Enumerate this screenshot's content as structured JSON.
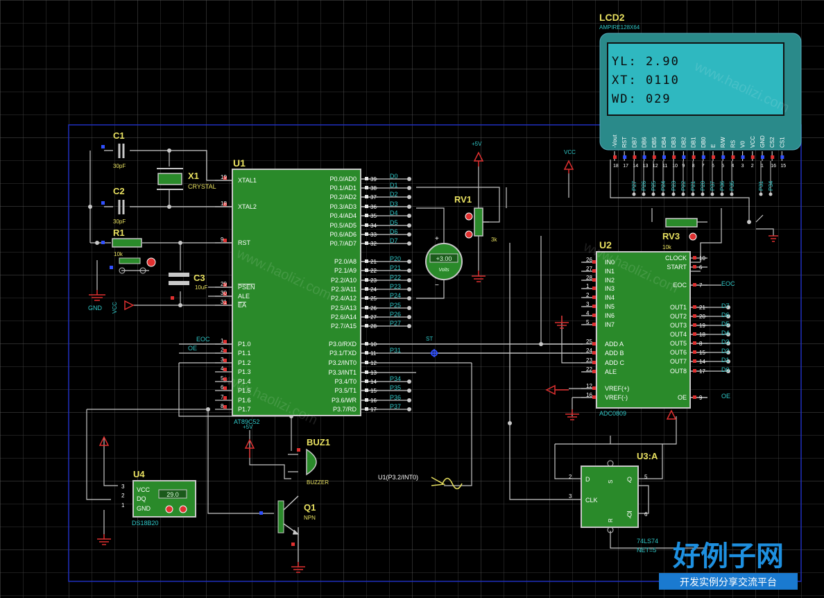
{
  "colors": {
    "background": "#000000",
    "grid": "#3a3a3a",
    "wire": "#c8c8c8",
    "chip_fill": "#2a8a2a",
    "chip_border": "#c8c8c8",
    "label_yellow": "#e8e060",
    "net_cyan": "#30c8c8",
    "pin_red": "#e03030",
    "power_red": "#e03030",
    "lcd_bg": "#2fb8c0",
    "sheet_border": "#2030c0"
  },
  "u1": {
    "ref": "U1",
    "part": "AT89C52",
    "left_pins": [
      {
        "num": "19",
        "name": "XTAL1"
      },
      {
        "num": "18",
        "name": "XTAL2"
      },
      {
        "num": "9",
        "name": "RST"
      },
      {
        "num": "29",
        "name": "PSEN"
      },
      {
        "num": "30",
        "name": "ALE"
      },
      {
        "num": "31",
        "name": "EA"
      },
      {
        "num": "1",
        "name": "P1.0"
      },
      {
        "num": "2",
        "name": "P1.1"
      },
      {
        "num": "3",
        "name": "P1.2"
      },
      {
        "num": "4",
        "name": "P1.3"
      },
      {
        "num": "5",
        "name": "P1.4"
      },
      {
        "num": "6",
        "name": "P1.5"
      },
      {
        "num": "7",
        "name": "P1.6"
      },
      {
        "num": "8",
        "name": "P1.7"
      }
    ],
    "right_pins": [
      {
        "num": "39",
        "name": "P0.0/AD0",
        "net": "D0"
      },
      {
        "num": "38",
        "name": "P0.1/AD1",
        "net": "D1"
      },
      {
        "num": "37",
        "name": "P0.2/AD2",
        "net": "D2"
      },
      {
        "num": "36",
        "name": "P0.3/AD3",
        "net": "D3"
      },
      {
        "num": "35",
        "name": "P0.4/AD4",
        "net": "D4"
      },
      {
        "num": "34",
        "name": "P0.5/AD5",
        "net": "D5"
      },
      {
        "num": "33",
        "name": "P0.6/AD6",
        "net": "D6"
      },
      {
        "num": "32",
        "name": "P0.7/AD7",
        "net": "D7"
      },
      {
        "num": "21",
        "name": "P2.0/A8",
        "net": "P20"
      },
      {
        "num": "22",
        "name": "P2.1/A9",
        "net": "P21"
      },
      {
        "num": "23",
        "name": "P2.2/A10",
        "net": "P22"
      },
      {
        "num": "24",
        "name": "P2.3/A11",
        "net": "P23"
      },
      {
        "num": "25",
        "name": "P2.4/A12",
        "net": "P24"
      },
      {
        "num": "26",
        "name": "P2.5/A13",
        "net": "P25"
      },
      {
        "num": "27",
        "name": "P2.6/A14",
        "net": "P26"
      },
      {
        "num": "28",
        "name": "P2.7/A15",
        "net": "P27"
      },
      {
        "num": "10",
        "name": "P3.0/RXD",
        "net": ""
      },
      {
        "num": "11",
        "name": "P3.1/TXD",
        "net": "P31"
      },
      {
        "num": "12",
        "name": "P3.2/INT0",
        "net": ""
      },
      {
        "num": "13",
        "name": "P3.3/INT1",
        "net": ""
      },
      {
        "num": "14",
        "name": "P3.4/T0",
        "net": "P34"
      },
      {
        "num": "15",
        "name": "P3.5/T1",
        "net": "P35"
      },
      {
        "num": "16",
        "name": "P3.6/WR",
        "net": "P36"
      },
      {
        "num": "17",
        "name": "P3.7/RD",
        "net": "P37"
      }
    ],
    "left_nets": {
      "p10": "EOC",
      "p11": "OE"
    }
  },
  "u2": {
    "ref": "U2",
    "part": "ADC0809",
    "left_pins": [
      {
        "num": "26",
        "name": "IN0"
      },
      {
        "num": "27",
        "name": "IN1"
      },
      {
        "num": "28",
        "name": "IN2"
      },
      {
        "num": "1",
        "name": "IN3"
      },
      {
        "num": "2",
        "name": "IN4"
      },
      {
        "num": "3",
        "name": "IN5"
      },
      {
        "num": "4",
        "name": "IN6"
      },
      {
        "num": "5",
        "name": "IN7"
      },
      {
        "num": "25",
        "name": "ADD A"
      },
      {
        "num": "24",
        "name": "ADD B"
      },
      {
        "num": "23",
        "name": "ADD C"
      },
      {
        "num": "22",
        "name": "ALE"
      },
      {
        "num": "12",
        "name": "VREF(+)"
      },
      {
        "num": "16",
        "name": "VREF(-)"
      }
    ],
    "right_pins": [
      {
        "num": "10",
        "name": "CLOCK",
        "net": ""
      },
      {
        "num": "6",
        "name": "START",
        "net": ""
      },
      {
        "num": "7",
        "name": "EOC",
        "net": "EOC"
      },
      {
        "num": "21",
        "name": "OUT1",
        "net": "D7"
      },
      {
        "num": "20",
        "name": "OUT2",
        "net": "D6"
      },
      {
        "num": "19",
        "name": "OUT3",
        "net": "D5"
      },
      {
        "num": "18",
        "name": "OUT4",
        "net": "D4"
      },
      {
        "num": "8",
        "name": "OUT5",
        "net": "D3"
      },
      {
        "num": "15",
        "name": "OUT6",
        "net": "D2"
      },
      {
        "num": "14",
        "name": "OUT7",
        "net": "D1"
      },
      {
        "num": "17",
        "name": "OUT8",
        "net": "D0"
      },
      {
        "num": "9",
        "name": "OE",
        "net": "OE"
      }
    ]
  },
  "lcd": {
    "ref": "LCD2",
    "part": "AMPIRE128X64",
    "lines": [
      "YL:  2.90",
      "XT:  0110",
      "WD:  029"
    ],
    "pins": [
      "-Vout",
      "RST",
      "DB7",
      "DB6",
      "DB5",
      "DB4",
      "DB3",
      "DB2",
      "DB1",
      "DB0",
      "E",
      "R/W",
      "RS",
      "V0",
      "VCC",
      "GND",
      "CS2",
      "CS1"
    ],
    "pin_nums": [
      "18",
      "17",
      "14",
      "13",
      "12",
      "11",
      "10",
      "9",
      "8",
      "7",
      "6",
      "5",
      "4",
      "3",
      "2",
      "1",
      "16",
      "15"
    ],
    "nets": [
      "P27",
      "P26",
      "P25",
      "P24",
      "P23",
      "P22",
      "P21",
      "P20",
      "P37",
      "P36",
      "P35",
      "P31",
      "P34"
    ]
  },
  "components": {
    "c1": {
      "ref": "C1",
      "value": "30pF"
    },
    "c2": {
      "ref": "C2",
      "value": "30pF"
    },
    "c3": {
      "ref": "C3",
      "value": "10uF"
    },
    "r1": {
      "ref": "R1",
      "value": "10k"
    },
    "x1": {
      "ref": "X1",
      "value": "CRYSTAL"
    },
    "rv1": {
      "ref": "RV1",
      "value": "3k"
    },
    "rv3": {
      "ref": "RV3",
      "value": "10k"
    },
    "voltmeter": {
      "reading": "+3.00",
      "unit": "Volts"
    },
    "buz1": {
      "ref": "BUZ1",
      "value": "BUZZER"
    },
    "q1": {
      "ref": "Q1",
      "value": "NPN"
    },
    "u4": {
      "ref": "U4",
      "part": "DS18B20",
      "pins": [
        "VCC",
        "DQ",
        "GND"
      ],
      "pin_nums": [
        "3",
        "2",
        "1"
      ],
      "reading": "29.0"
    },
    "u3": {
      "ref": "U3:A",
      "part": "74LS74",
      "net_label": "NET=5",
      "pins": [
        "D",
        "CLK",
        "Q",
        "Q"
      ],
      "pin_nums": [
        "2",
        "3",
        "5",
        "6"
      ],
      "top": "S",
      "bottom": "R"
    },
    "generator": {
      "label": "U1(P3.2/INT0)"
    }
  },
  "power": {
    "plus5v": "+5V",
    "vcc": "VCC",
    "gnd": "GND",
    "st": "ST"
  },
  "watermark": {
    "title": "好例子网",
    "subtitle": "开发实例分享交流平台",
    "diagonal": "www.haolizi.com"
  }
}
